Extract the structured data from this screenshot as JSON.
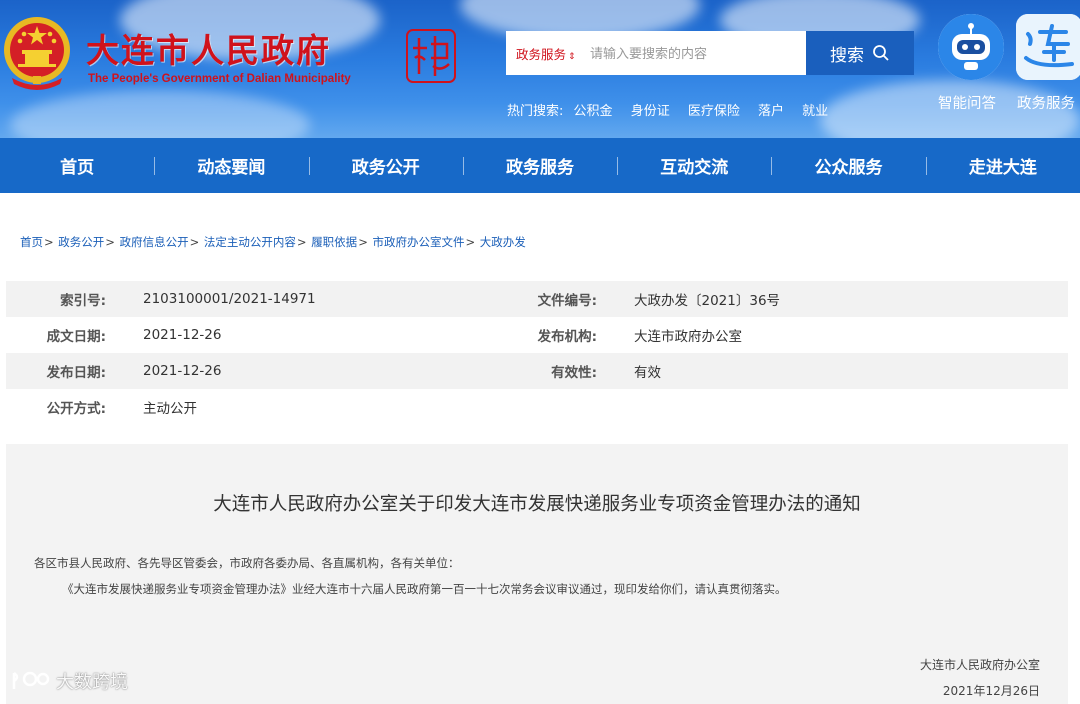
{
  "header": {
    "title": "大连市人民政府",
    "subtitle": "The People's Government of Dalian Municipality",
    "search": {
      "category": "政务服务",
      "placeholder": "请输入要搜索的内容",
      "button": "搜索"
    },
    "hot": {
      "label": "热门搜索:",
      "items": [
        "公积金",
        "身份证",
        "医疗保险",
        "落户",
        "就业"
      ]
    },
    "apps": [
      {
        "label": "智能问答",
        "icon": "robot-icon"
      },
      {
        "label": "政务服务",
        "icon": "lian-glyph-icon"
      }
    ],
    "colors": {
      "banner": "#2b7de0",
      "title_red": "#d0121b"
    }
  },
  "nav": {
    "items": [
      "首页",
      "动态要闻",
      "政务公开",
      "政务服务",
      "互动交流",
      "公众服务",
      "走进大连"
    ],
    "color": "#1769c8"
  },
  "breadcrumb": [
    "首页",
    "政务公开",
    "政府信息公开",
    "法定主动公开内容",
    "履职依据",
    "市政府办公室文件",
    "大政办发"
  ],
  "meta": {
    "index_label": "索引号:",
    "index_value": "2103100001/2021-14971",
    "docno_label": "文件编号:",
    "docno_value": "大政办发〔2021〕36号",
    "created_label": "成文日期:",
    "created_value": "2021-12-26",
    "issuer_label": "发布机构:",
    "issuer_value": "大连市政府办公室",
    "published_label": "发布日期:",
    "published_value": "2021-12-26",
    "validity_label": "有效性:",
    "validity_value": "有效",
    "mode_label": "公开方式:",
    "mode_value": "主动公开"
  },
  "article": {
    "title": "大连市人民政府办公室关于印发大连市发展快递服务业专项资金管理办法的通知",
    "addressee": "各区市县人民政府、各先导区管委会，市政府各委办局、各直属机构，各有关单位：",
    "body": "《大连市发展快递服务业专项资金管理办法》业经大连市十六届人民政府第一百一十七次常务会议审议通过，现印发给你们，请认真贯彻落实。",
    "signature": "大连市人民政府办公室",
    "date": "2021年12月26日"
  },
  "watermark": "大数跨境"
}
